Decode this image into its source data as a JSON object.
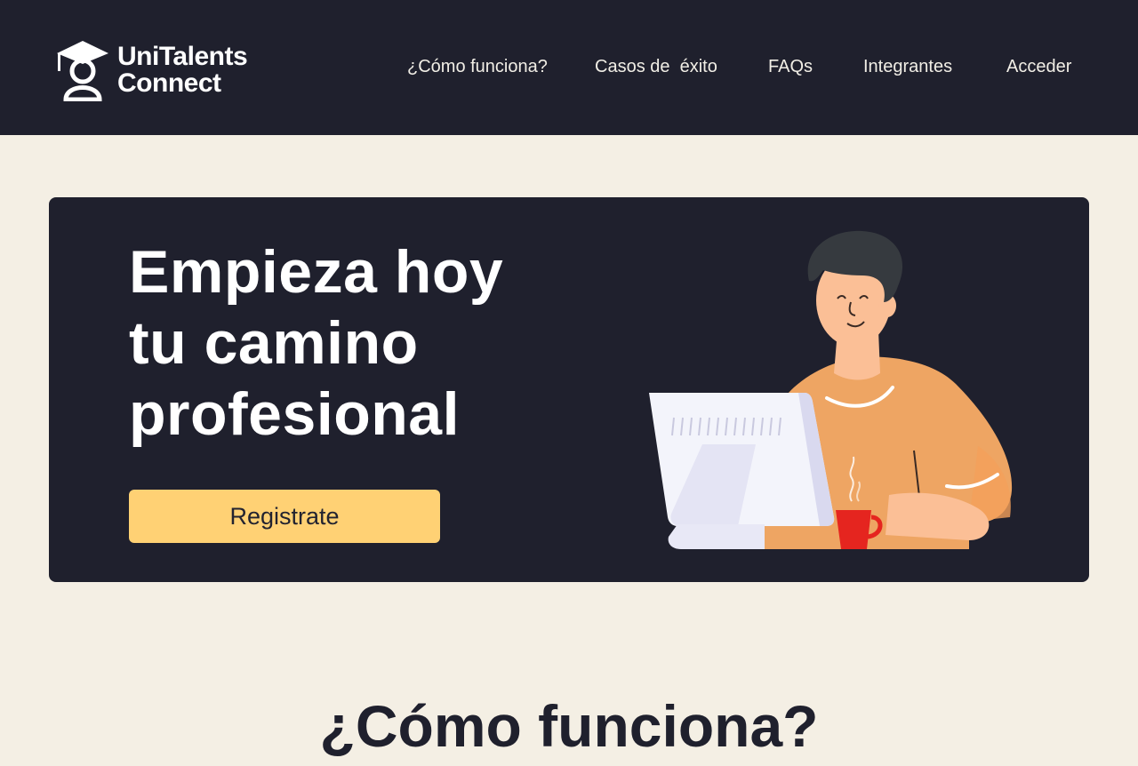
{
  "brand": {
    "name_line1": "UniTalents",
    "name_line2": "Connect",
    "icon": "graduate-person-icon"
  },
  "nav": {
    "items": [
      {
        "label": "¿Cómo funciona?"
      },
      {
        "label": "Casos de  éxito"
      },
      {
        "label": "FAQs"
      },
      {
        "label": "Integrantes"
      },
      {
        "label": "Acceder"
      }
    ]
  },
  "hero": {
    "title_lines": [
      "Empieza hoy",
      "tu camino",
      "profesional"
    ],
    "cta_label": "Registrate",
    "illustration": "person-at-computer-with-coffee"
  },
  "section": {
    "title": "¿Cómo funciona?"
  },
  "colors": {
    "navbar_bg": "#1f202d",
    "page_bg": "#f4efe4",
    "hero_bg": "#1f202d",
    "cta_bg": "#ffd174",
    "text_light": "#ffffff",
    "text_dark": "#1f202d"
  }
}
